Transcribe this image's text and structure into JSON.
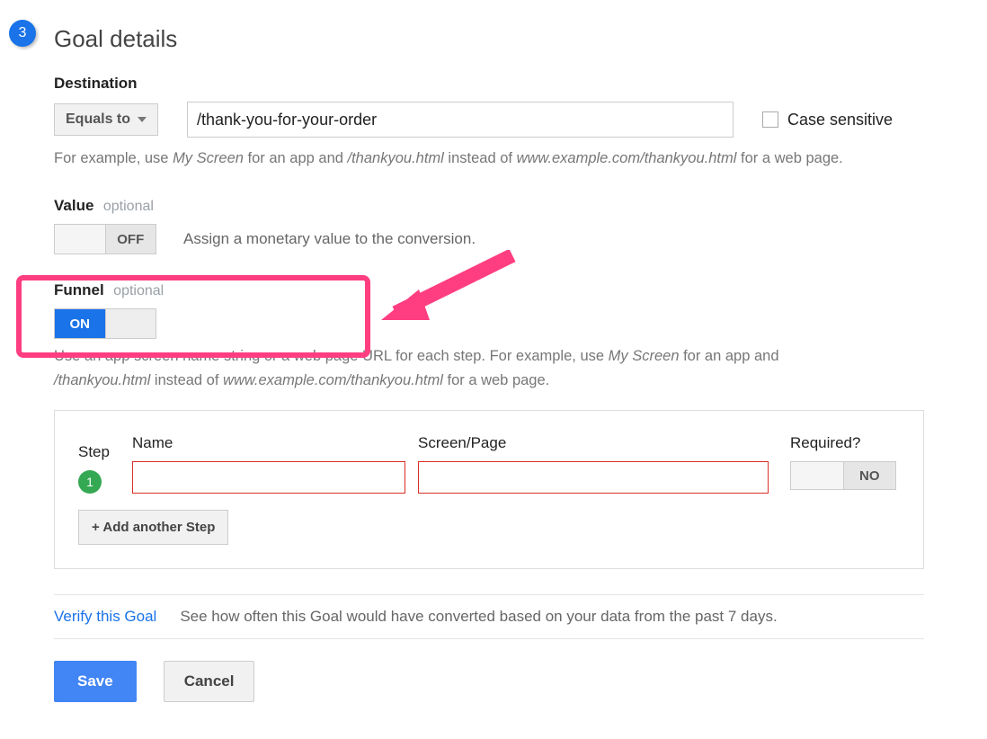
{
  "header": {
    "step_number": "3",
    "title": "Goal details"
  },
  "destination": {
    "label": "Destination",
    "match_type": "Equals to",
    "value": "/thank-you-for-your-order",
    "case_sensitive_label": "Case sensitive",
    "help_prefix": "For example, use ",
    "help_em1": "My Screen",
    "help_mid1": " for an app and ",
    "help_em2": "/thankyou.html",
    "help_mid2": " instead of ",
    "help_em3": "www.example.com/thankyou.html",
    "help_suffix": " for a web page."
  },
  "value": {
    "label": "Value",
    "optional": "optional",
    "toggle_state": "OFF",
    "description": "Assign a monetary value to the conversion."
  },
  "funnel": {
    "label": "Funnel",
    "optional": "optional",
    "toggle_state": "ON",
    "help_line1_prefix": "Use an app screen name string or a web page URL for each step. For example, use ",
    "help_line1_em": "My Screen",
    "help_line1_mid": " for an app and ",
    "help_line2_em1": "/thankyou.html",
    "help_line2_mid": " instead of ",
    "help_line2_em2": "www.example.com/thankyou.html",
    "help_line2_suffix": " for a web page.",
    "columns": {
      "step": "Step",
      "name": "Name",
      "page": "Screen/Page",
      "required": "Required?"
    },
    "steps": [
      {
        "num": "1",
        "name": "",
        "page": "",
        "required": "NO"
      }
    ],
    "add_button": "+ Add another Step"
  },
  "verify": {
    "link": "Verify this Goal",
    "desc": "See how often this Goal would have converted based on your data from the past 7 days."
  },
  "actions": {
    "save": "Save",
    "cancel": "Cancel"
  }
}
